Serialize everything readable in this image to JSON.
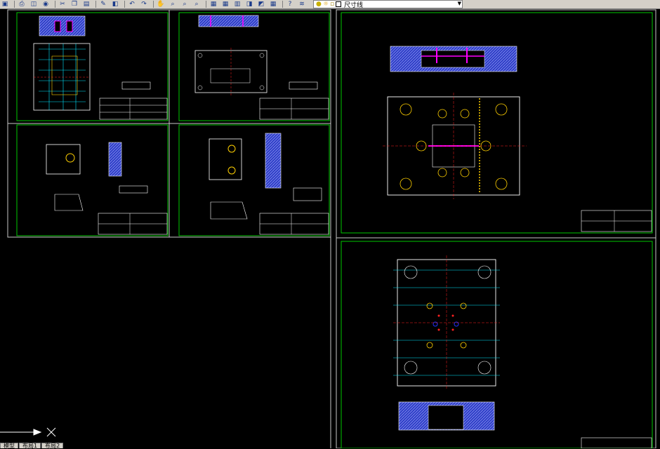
{
  "toolbar": {
    "buttons": [
      {
        "icon": "save-icon",
        "glyph": "▣"
      },
      {
        "icon": "print-icon",
        "glyph": "⎙"
      },
      {
        "icon": "preview-icon",
        "glyph": "◫"
      },
      {
        "icon": "publish-icon",
        "glyph": "◉"
      },
      {
        "icon": "cut-icon",
        "glyph": "✂"
      },
      {
        "icon": "copy-icon",
        "glyph": "❐"
      },
      {
        "icon": "paste-icon",
        "glyph": "▤"
      },
      {
        "icon": "match-properties-icon",
        "glyph": "✎"
      },
      {
        "icon": "block-editor-icon",
        "glyph": "◧"
      },
      {
        "icon": "undo-icon",
        "glyph": "↶"
      },
      {
        "icon": "redo-icon",
        "glyph": "↷"
      },
      {
        "icon": "pan-icon",
        "glyph": "✋"
      },
      {
        "icon": "zoom-realtime-icon",
        "glyph": "⌕"
      },
      {
        "icon": "zoom-window-icon",
        "glyph": "⌕"
      },
      {
        "icon": "zoom-previous-icon",
        "glyph": "⌕"
      },
      {
        "icon": "properties-icon",
        "glyph": "▦"
      },
      {
        "icon": "design-center-icon",
        "glyph": "▦"
      },
      {
        "icon": "tool-palettes-icon",
        "glyph": "▥"
      },
      {
        "icon": "sheet-set-icon",
        "glyph": "◨"
      },
      {
        "icon": "markup-icon",
        "glyph": "◩"
      },
      {
        "icon": "calculator-icon",
        "glyph": "▦"
      },
      {
        "icon": "help-icon",
        "glyph": "?"
      },
      {
        "icon": "layer-manager-icon",
        "glyph": "≋"
      }
    ],
    "layer_icons": [
      "lightbulb-icon",
      "sun-icon",
      "lock-icon",
      "color-swatch-icon"
    ],
    "current_layer": "尺寸线"
  },
  "tabs": [
    "模型",
    "布局1",
    "布局2"
  ],
  "colors": {
    "frame": "#00c800",
    "line": "#ffffff",
    "magenta": "#ff00ff",
    "cyan": "#00e5ff",
    "yellow": "#ffd000",
    "red": "#ff2020",
    "blue": "#2030ff",
    "hatch": "#3040c8"
  }
}
